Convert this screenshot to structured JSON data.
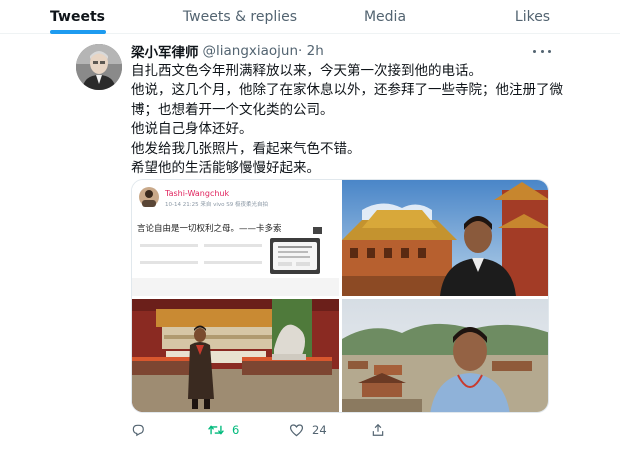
{
  "tabs": [
    {
      "label": "Tweets",
      "active": true
    },
    {
      "label": "Tweets & replies",
      "active": false
    },
    {
      "label": "Media",
      "active": false
    },
    {
      "label": "Likes",
      "active": false
    }
  ],
  "tweet": {
    "author_name": "梁小军律师",
    "author_handle": "@liangxiaojun",
    "time": "· 2h",
    "lines": [
      "自扎西文色今年刑满释放以来，今天第一次接到他的电话。",
      "他说，这几个月，他除了在家休息以外，还参拜了一些寺院；他注册了微",
      "博；也想着开一个文化类的公司。",
      "他说自己身体还好。",
      "他发给我几张照片，看起来气色不错。",
      "希望他的生活能够慢慢好起来。"
    ],
    "screenshot": {
      "name": "Tashi-Wangchuk",
      "meta": "10-14 21:25 来自 vivo S9 极夜柔光自拍",
      "quote": "言论自由是一切权利之母。——卡多索"
    },
    "stats": {
      "replies": "",
      "retweets": "6",
      "likes": "24"
    }
  },
  "colors": {
    "accent": "#1d9bf0",
    "retweet_active": "#00ba7c",
    "secondary_text": "#536471",
    "weibo_name": "#e0245e"
  },
  "icons": {
    "reply": "reply-icon",
    "retweet": "retweet-icon",
    "like": "heart-icon",
    "share": "share-icon",
    "more": "more-icon"
  }
}
